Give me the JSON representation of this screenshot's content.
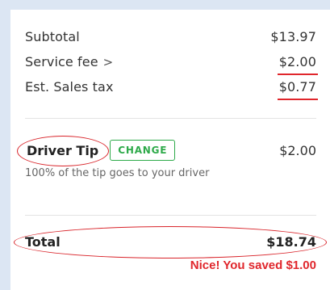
{
  "summary": {
    "subtotal": {
      "label": "Subtotal",
      "amount": "$13.97"
    },
    "service_fee": {
      "label": "Service fee",
      "chevron": ">",
      "amount": "$2.00"
    },
    "sales_tax": {
      "label": "Est. Sales tax",
      "amount": "$0.77"
    }
  },
  "tip": {
    "label": "Driver Tip",
    "change_label": "CHANGE",
    "amount": "$2.00",
    "note": "100% of the tip goes to your driver"
  },
  "total": {
    "label": "Total",
    "amount": "$18.74",
    "savings": "Nice! You saved $1.00"
  },
  "colors": {
    "annotation_red": "#e0262c",
    "change_green": "#2eaa4a",
    "page_background": "#dce6f3"
  }
}
